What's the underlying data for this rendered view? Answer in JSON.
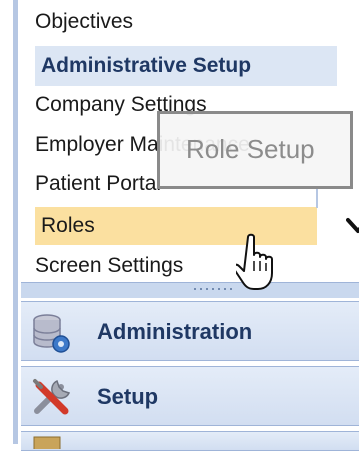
{
  "nav": {
    "items": [
      {
        "label": "Objectives"
      },
      {
        "label": "Administrative Setup"
      },
      {
        "label": "Company Settings"
      },
      {
        "label": "Employer Maintenance"
      },
      {
        "label": "Patient Portal"
      },
      {
        "label": "Roles"
      },
      {
        "label": "Screen Settings"
      }
    ],
    "selected_index": 5
  },
  "tooltip": {
    "text": "Role Setup"
  },
  "outlook_buttons": [
    {
      "label": "Administration",
      "icon": "database-gear-icon"
    },
    {
      "label": "Setup",
      "icon": "tools-icon"
    }
  ],
  "colors": {
    "header_bg": "#dce6f4",
    "selected_bg": "#fbe0a0",
    "panel_accent": "#c9d8ee",
    "header_text": "#1f3864"
  }
}
